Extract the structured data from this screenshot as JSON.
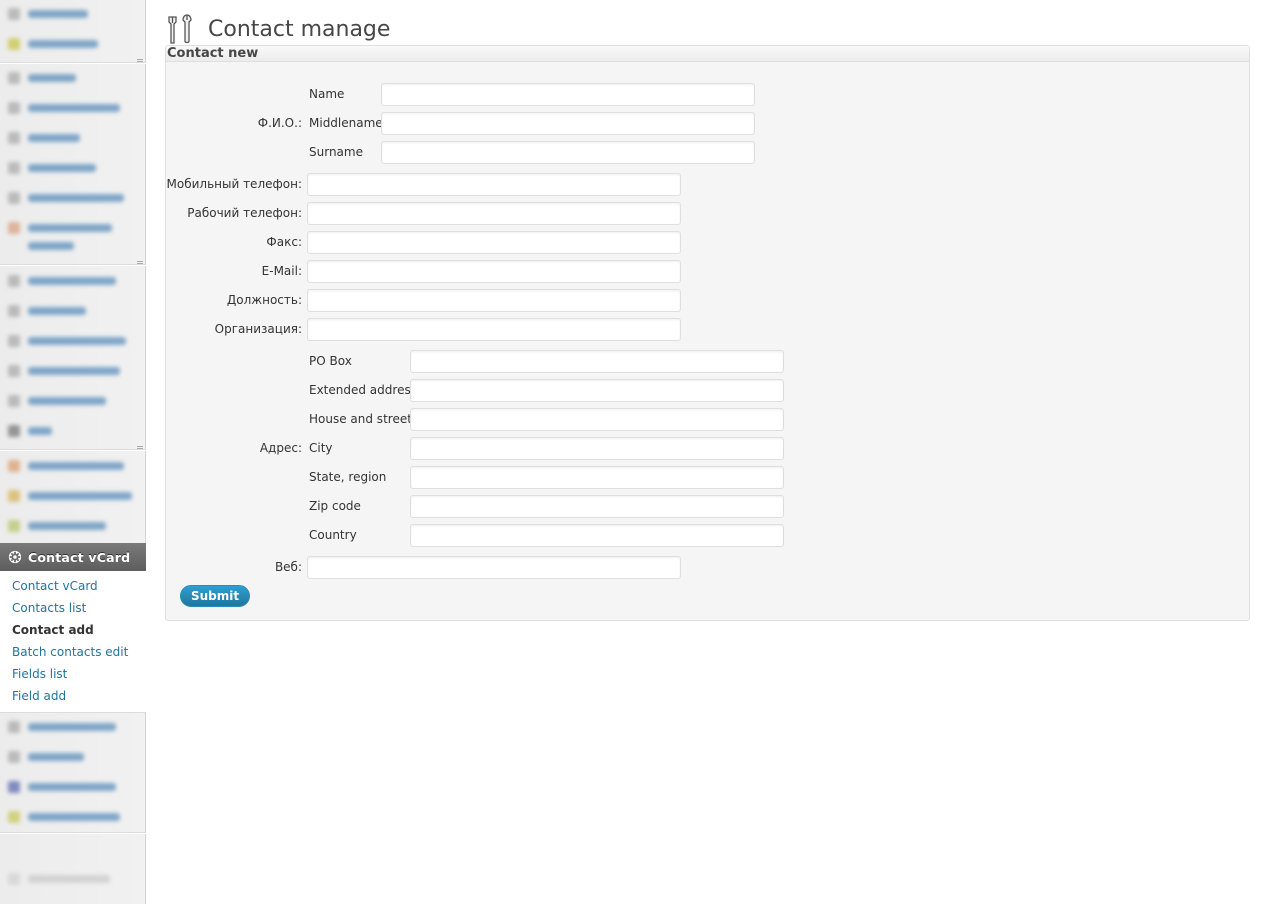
{
  "sidebar": {
    "active_menu": {
      "label": "Contact vCard",
      "icon": "gear-icon"
    },
    "submenu": [
      {
        "label": "Contact vCard",
        "current": false
      },
      {
        "label": "Contacts list",
        "current": false
      },
      {
        "label": "Contact add",
        "current": true
      },
      {
        "label": "Batch contacts edit",
        "current": false
      },
      {
        "label": "Fields list",
        "current": false
      },
      {
        "label": "Field add",
        "current": false
      }
    ]
  },
  "page": {
    "title": "Contact manage",
    "title_icon": "tools-icon"
  },
  "form": {
    "title": "Contact new",
    "fio_label": "Ф.И.О.:",
    "name_label": "Name",
    "middlename_label": "Middlename",
    "surname_label": "Surname",
    "mobile_label": "Мобильный телефон:",
    "work_phone_label": "Рабочий телефон:",
    "fax_label": "Факс:",
    "email_label": "E-Mail:",
    "position_label": "Должность:",
    "organization_label": "Организация:",
    "address_label": "Адрес:",
    "po_box_label": "PO Box",
    "extended_address_label": "Extended address",
    "house_street_label": "House and street",
    "city_label": "City",
    "state_label": "State, region",
    "zip_label": "Zip code",
    "country_label": "Country",
    "web_label": "Веб:",
    "submit_label": "Submit"
  },
  "colors": {
    "link": "#21759b",
    "button": "#21759b",
    "menu_active": "#6c6c6c"
  }
}
